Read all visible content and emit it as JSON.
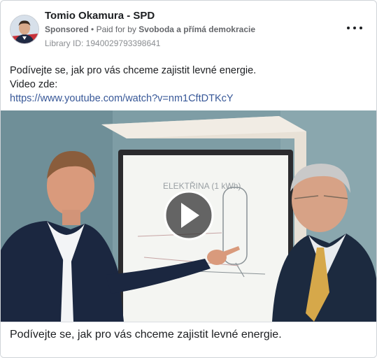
{
  "post": {
    "page_name": "Tomio Okamura - SPD",
    "sponsored_label": "Sponsored",
    "paid_for_prefix": "Paid for by",
    "payer": "Svoboda a přímá demokracie",
    "library_id": "Library ID: 1940029793398641",
    "more_icon": "more-horizontal-icon",
    "text_lines": [
      "Podívejte se, jak pro vás chceme zajistit levné energie.",
      "Video zde:"
    ],
    "link": "https://www.youtube.com/watch?v=nm1CftDTKcY"
  },
  "media": {
    "type": "video",
    "play_icon": "play-icon",
    "whiteboard_text": "ELEKTŘINA (1 kWh)",
    "caption": "Podívejte se, jak pro vás chceme zajistit levné energie."
  },
  "colors": {
    "link": "#385898",
    "secondary_text": "#65676b",
    "border": "#cfd3d8"
  }
}
